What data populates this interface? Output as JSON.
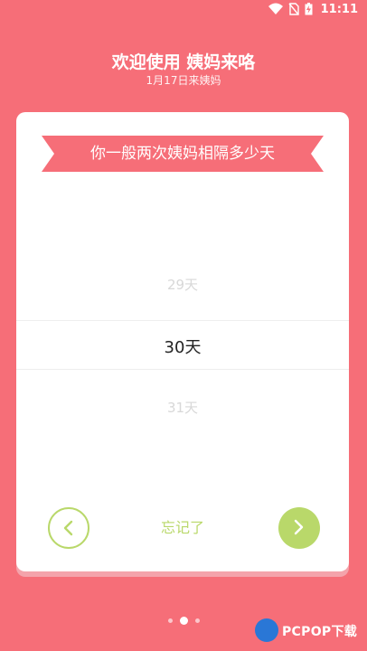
{
  "status_bar": {
    "time": "11:11",
    "icons": [
      "wifi-icon",
      "no-sim-icon",
      "battery-charging-icon"
    ]
  },
  "header": {
    "title": "欢迎使用 姨妈来咯",
    "subtitle": "1月17日来姨妈"
  },
  "card": {
    "question": "你一般两次姨妈相隔多少天",
    "picker": {
      "prev": "29天",
      "current": "30天",
      "next": "31天"
    },
    "forgot_label": "忘记了"
  },
  "pagination": {
    "pages": 3,
    "current": 2
  },
  "watermark": {
    "text": "PCPOP下载"
  },
  "colors": {
    "background": "#f66e78",
    "accent_green": "#b9d86a",
    "ribbon": "#f66e78"
  }
}
